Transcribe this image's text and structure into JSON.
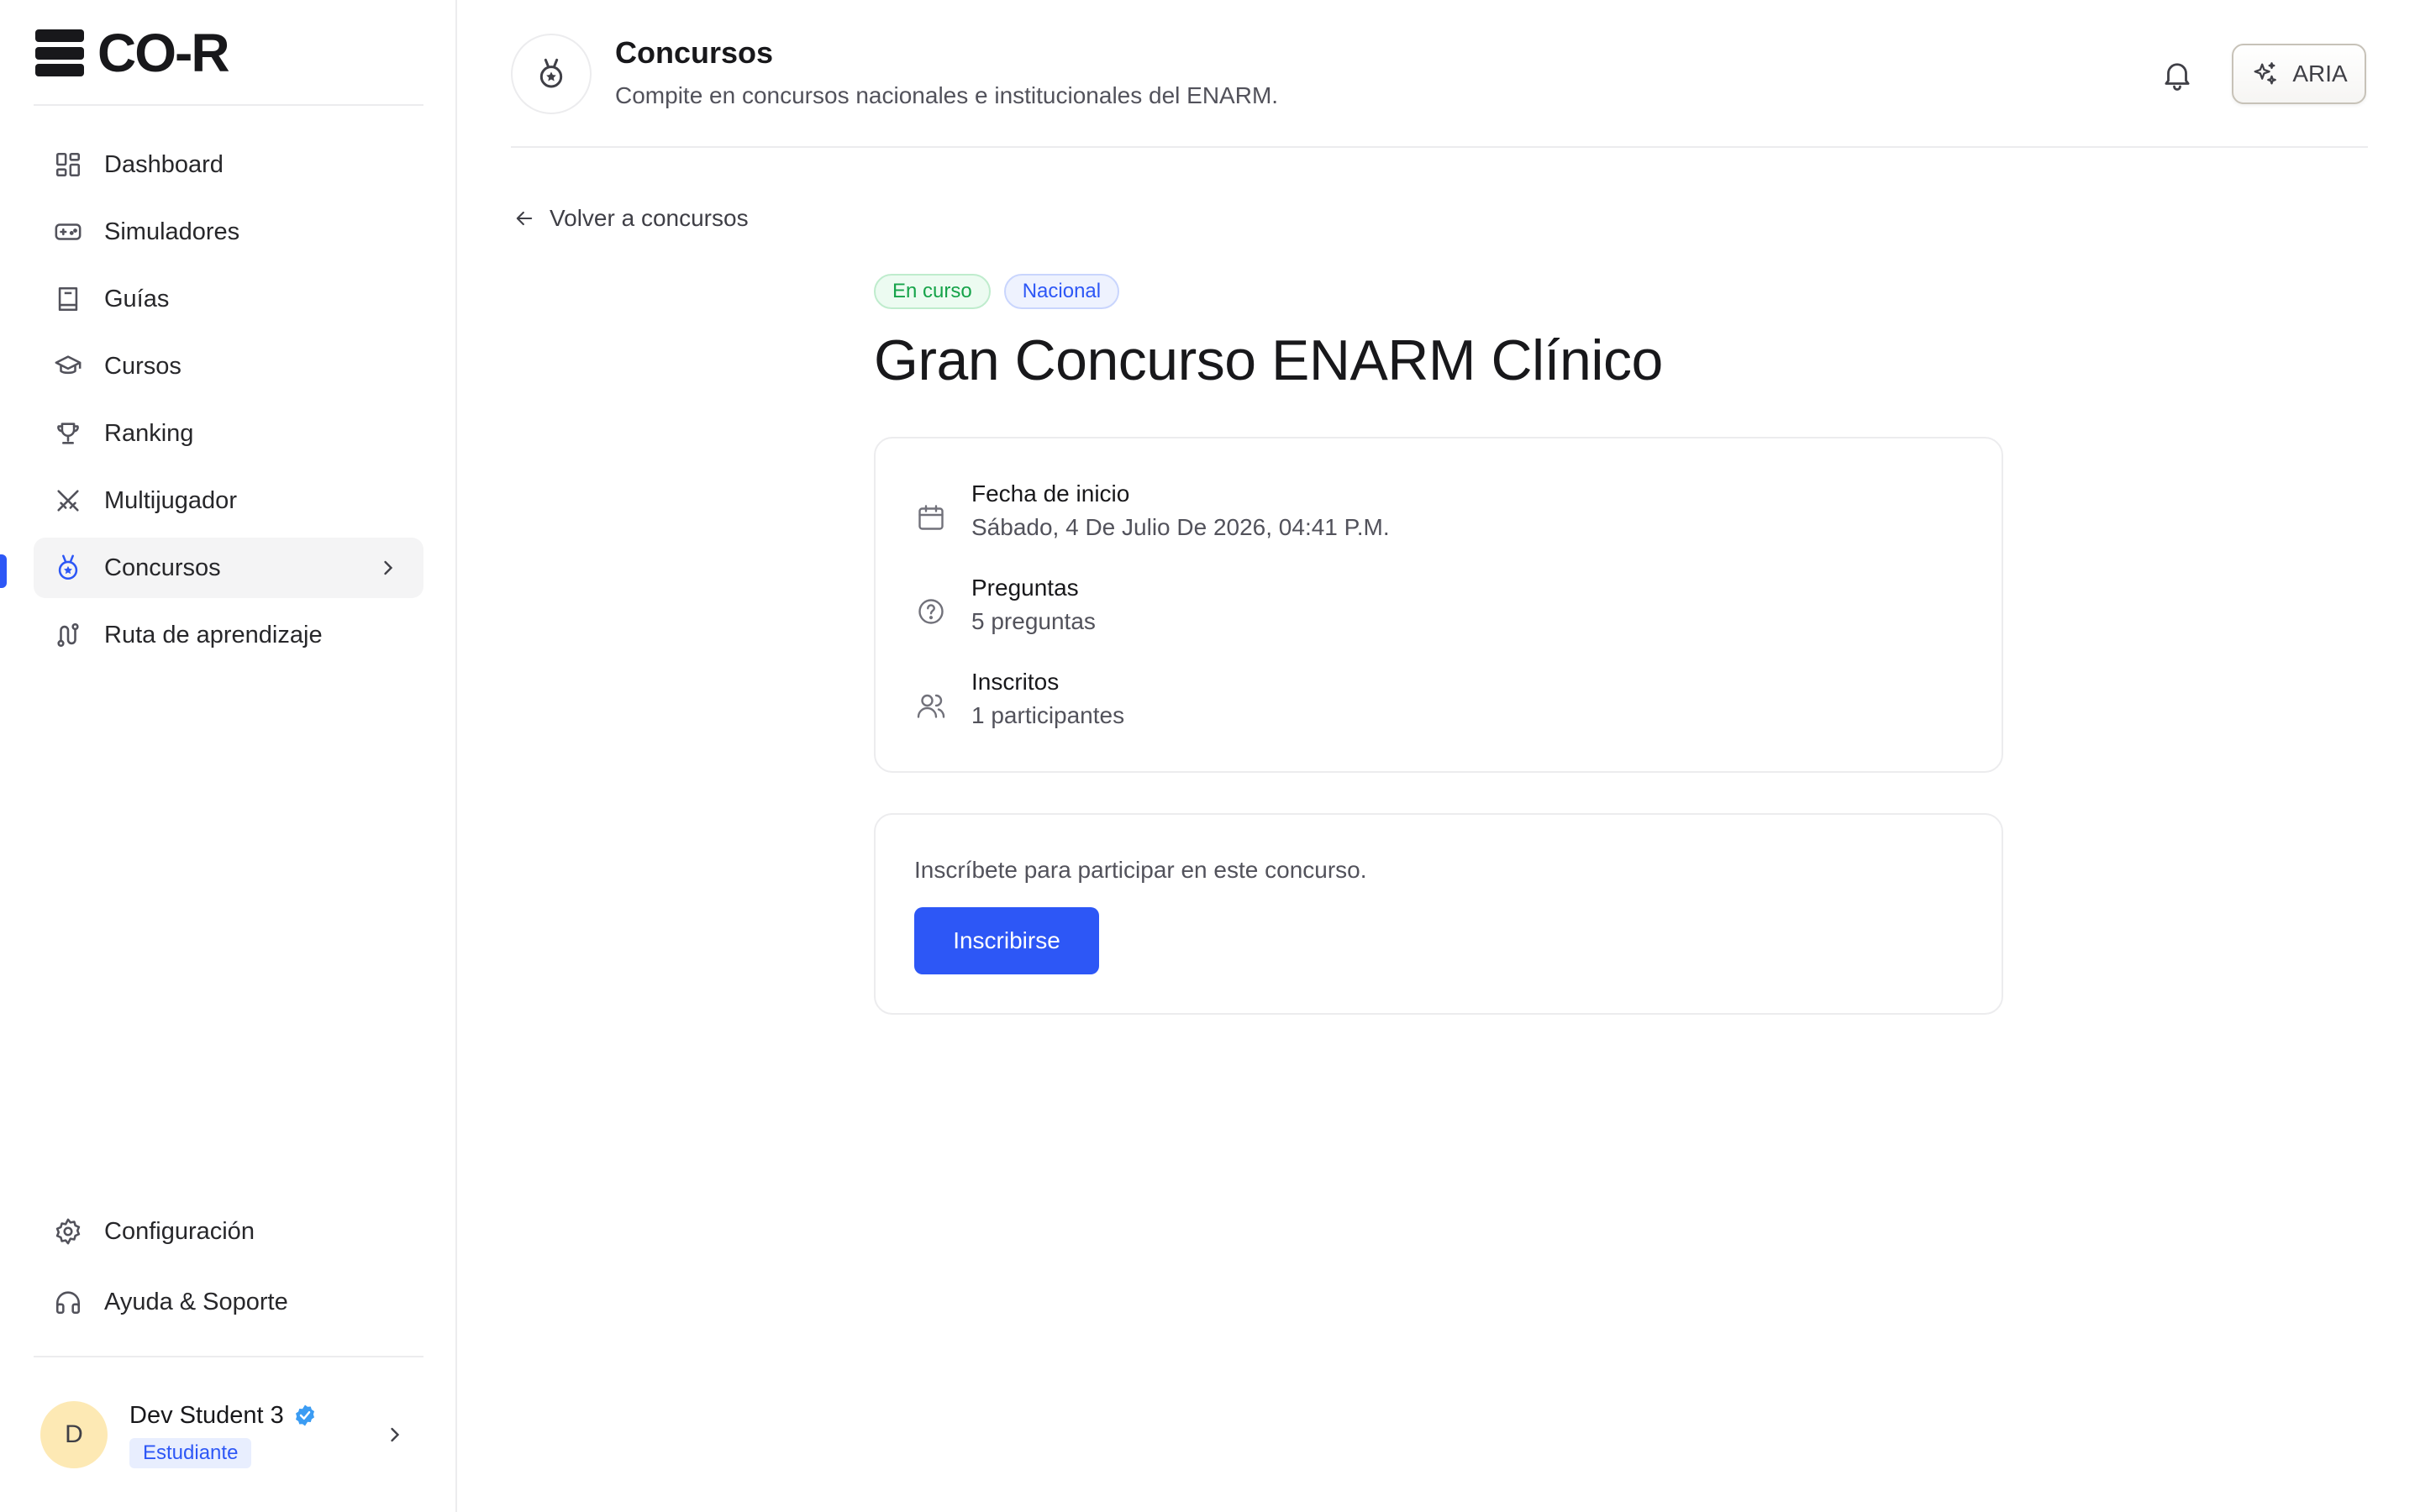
{
  "brand": {
    "name": "CO-R"
  },
  "sidebar": {
    "items": [
      {
        "label": "Dashboard",
        "icon": "dashboard-icon"
      },
      {
        "label": "Simuladores",
        "icon": "gamepad-icon"
      },
      {
        "label": "Guías",
        "icon": "book-icon"
      },
      {
        "label": "Cursos",
        "icon": "graduation-cap-icon"
      },
      {
        "label": "Ranking",
        "icon": "trophy-icon"
      },
      {
        "label": "Multijugador",
        "icon": "swords-icon"
      },
      {
        "label": "Concursos",
        "icon": "medal-icon",
        "active": true
      },
      {
        "label": "Ruta de aprendizaje",
        "icon": "route-icon"
      }
    ],
    "bottom": [
      {
        "label": "Configuración",
        "icon": "gear-icon"
      },
      {
        "label": "Ayuda & Soporte",
        "icon": "headphones-icon"
      }
    ],
    "user": {
      "initial": "D",
      "name": "Dev Student 3",
      "role": "Estudiante"
    }
  },
  "header": {
    "title": "Concursos",
    "subtitle": "Compite en concursos nacionales e institucionales del ENARM.",
    "aria_label": "ARIA"
  },
  "main": {
    "back_label": "Volver a concursos",
    "badges": {
      "status": "En curso",
      "scope": "Nacional"
    },
    "title": "Gran Concurso ENARM Clínico",
    "info": {
      "start_label": "Fecha de inicio",
      "start_value": "Sábado, 4 De Julio De 2026, 04:41 P.M.",
      "questions_label": "Preguntas",
      "questions_value": "5 preguntas",
      "enrolled_label": "Inscritos",
      "enrolled_value": "1 participantes"
    },
    "enroll": {
      "text": "Inscríbete para participar en este concurso.",
      "button": "Inscribirse"
    }
  },
  "colors": {
    "accent": "#2d57f6",
    "success": "#16a34a",
    "border": "#ececee"
  }
}
